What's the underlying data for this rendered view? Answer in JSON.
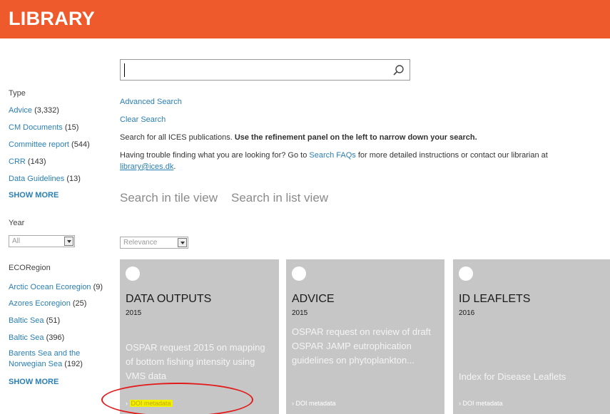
{
  "header": {
    "title": "LIBRARY"
  },
  "search": {
    "placeholder": "",
    "value": ""
  },
  "links": {
    "advanced_search": "Advanced Search",
    "clear_search": "Clear Search"
  },
  "info": {
    "line1_a": "Search for all ICES publications. ",
    "line1_b": "Use the refinement panel on the left to narrow down your search.",
    "line2_a": "Having trouble finding what you are looking for? Go to ",
    "line2_link": "Search FAQs",
    "line2_b": " for more detailed instructions or contact our librarian at",
    "line3_email": "library@ices.dk",
    "line3_end": "."
  },
  "views": {
    "tile": "Search in tile view",
    "list": "Search in list view"
  },
  "sort": {
    "selected": "Relevance"
  },
  "sidebar": {
    "type_heading": "Type",
    "type_items": [
      {
        "label": "Advice",
        "count": "(3,332)"
      },
      {
        "label": "CM Documents",
        "count": "(15)"
      },
      {
        "label": "Committee report",
        "count": "(544)"
      },
      {
        "label": "CRR",
        "count": "(143)"
      },
      {
        "label": "Data Guidelines",
        "count": "(13)"
      }
    ],
    "show_more": "SHOW MORE",
    "year_heading": "Year",
    "year_selected": "All",
    "eco_heading": "ECORegion",
    "eco_items": [
      {
        "label": "Arctic Ocean Ecoregion",
        "count": "(9)"
      },
      {
        "label": "Azores Ecoregion",
        "count": "(25)"
      },
      {
        "label": "Baltic Sea",
        "count": "(51)"
      },
      {
        "label": "Baltic Sea",
        "count": "(396)"
      },
      {
        "label": "Barents Sea and the Norwegian Sea",
        "count": "(192)"
      }
    ],
    "eco_show_more": "SHOW MORE"
  },
  "tiles": [
    {
      "type": "DATA OUTPUTS",
      "year": "2015",
      "description": "OSPAR request 2015 on mapping of bottom fishing intensity using VMS data",
      "doi": "DOI metadata"
    },
    {
      "type": "ADVICE",
      "year": "2015",
      "description": "OSPAR request on review of draft OSPAR JAMP eutrophication guidelines on phytoplankton...",
      "doi": "DOI metadata"
    },
    {
      "type": "ID LEAFLETS",
      "year": "2016",
      "description": "Index for Disease Leaflets",
      "doi": "DOI metadata"
    }
  ],
  "colors": {
    "header": "#ee5a2c",
    "link": "#2a7fb4",
    "tile": "#c6c6c6",
    "highlight": "#f0f000",
    "annotation": "#e21b1b"
  }
}
